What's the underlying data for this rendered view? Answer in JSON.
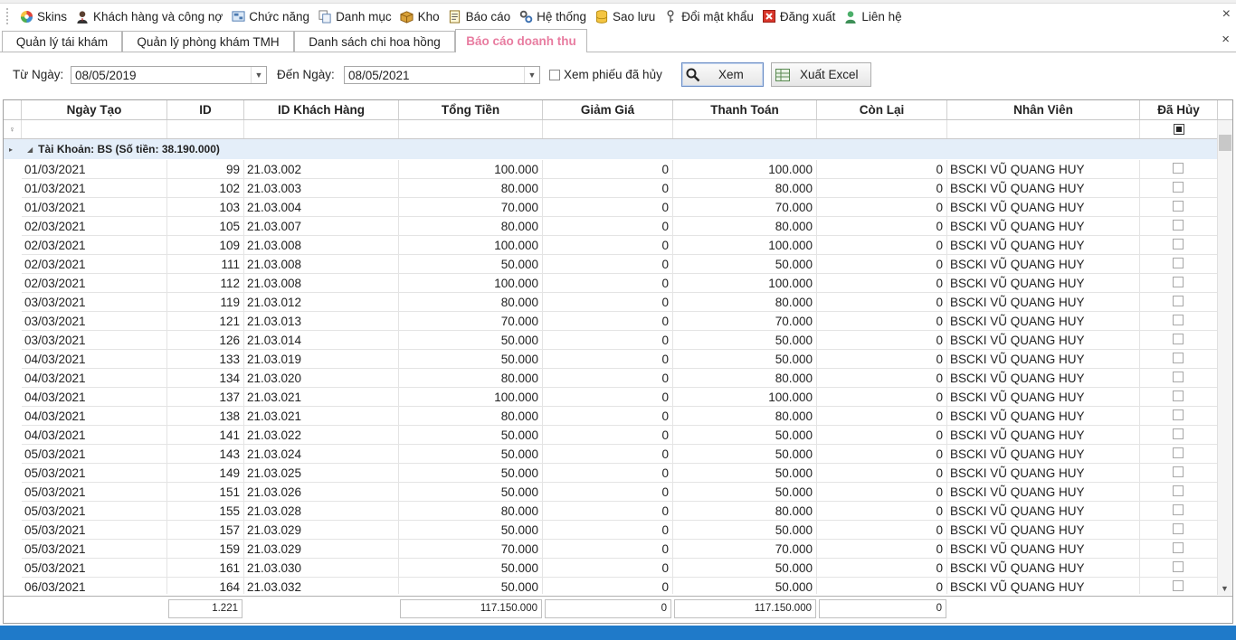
{
  "menu": {
    "items": [
      {
        "label": "Skins",
        "icon": "palette-icon"
      },
      {
        "label": "Khách hàng và công nợ",
        "icon": "user-icon"
      },
      {
        "label": "Chức năng",
        "icon": "function-icon"
      },
      {
        "label": "Danh mục",
        "icon": "category-icon"
      },
      {
        "label": "Kho",
        "icon": "box-icon"
      },
      {
        "label": "Báo cáo",
        "icon": "report-icon"
      },
      {
        "label": "Hệ thống",
        "icon": "settings-icon"
      },
      {
        "label": "Sao lưu",
        "icon": "database-icon"
      },
      {
        "label": "Đổi mật khẩu",
        "icon": "key-icon"
      },
      {
        "label": "Đăng xuất",
        "icon": "logout-icon"
      },
      {
        "label": "Liên hệ",
        "icon": "contact-icon"
      }
    ],
    "close_glyph": "×"
  },
  "tabs": [
    {
      "label": "Quản lý tái khám"
    },
    {
      "label": "Quản lý phòng khám TMH"
    },
    {
      "label": "Danh sách chi hoa hồng"
    },
    {
      "label": "Báo cáo doanh thu",
      "active": true
    }
  ],
  "filter": {
    "from_label": "Từ Ngày:",
    "from_value": "08/05/2019",
    "to_label": "Đến Ngày:",
    "to_value": "08/05/2021",
    "show_cancelled_label": "Xem phiếu đã hủy",
    "view_button": "Xem",
    "export_button": "Xuất Excel"
  },
  "grid": {
    "columns": [
      "Ngày Tạo",
      "ID",
      "ID Khách Hàng",
      "Tổng Tiền",
      "Giảm Giá",
      "Thanh Toán",
      "Còn Lại",
      "Nhân Viên",
      "Đã Hủy"
    ],
    "group_label": "Tài Khoản: BS (Số tiền: 38.190.000)",
    "rows": [
      [
        "01/03/2021",
        "99",
        "21.03.002",
        "100.000",
        "0",
        "100.000",
        "0",
        "BSCKI VŨ QUANG HUY"
      ],
      [
        "01/03/2021",
        "102",
        "21.03.003",
        "80.000",
        "0",
        "80.000",
        "0",
        "BSCKI VŨ QUANG HUY"
      ],
      [
        "01/03/2021",
        "103",
        "21.03.004",
        "70.000",
        "0",
        "70.000",
        "0",
        "BSCKI VŨ QUANG HUY"
      ],
      [
        "02/03/2021",
        "105",
        "21.03.007",
        "80.000",
        "0",
        "80.000",
        "0",
        "BSCKI VŨ QUANG HUY"
      ],
      [
        "02/03/2021",
        "109",
        "21.03.008",
        "100.000",
        "0",
        "100.000",
        "0",
        "BSCKI VŨ QUANG HUY"
      ],
      [
        "02/03/2021",
        "111",
        "21.03.008",
        "50.000",
        "0",
        "50.000",
        "0",
        "BSCKI VŨ QUANG HUY"
      ],
      [
        "02/03/2021",
        "112",
        "21.03.008",
        "100.000",
        "0",
        "100.000",
        "0",
        "BSCKI VŨ QUANG HUY"
      ],
      [
        "03/03/2021",
        "119",
        "21.03.012",
        "80.000",
        "0",
        "80.000",
        "0",
        "BSCKI VŨ QUANG HUY"
      ],
      [
        "03/03/2021",
        "121",
        "21.03.013",
        "70.000",
        "0",
        "70.000",
        "0",
        "BSCKI VŨ QUANG HUY"
      ],
      [
        "03/03/2021",
        "126",
        "21.03.014",
        "50.000",
        "0",
        "50.000",
        "0",
        "BSCKI VŨ QUANG HUY"
      ],
      [
        "04/03/2021",
        "133",
        "21.03.019",
        "50.000",
        "0",
        "50.000",
        "0",
        "BSCKI VŨ QUANG HUY"
      ],
      [
        "04/03/2021",
        "134",
        "21.03.020",
        "80.000",
        "0",
        "80.000",
        "0",
        "BSCKI VŨ QUANG HUY"
      ],
      [
        "04/03/2021",
        "137",
        "21.03.021",
        "100.000",
        "0",
        "100.000",
        "0",
        "BSCKI VŨ QUANG HUY"
      ],
      [
        "04/03/2021",
        "138",
        "21.03.021",
        "80.000",
        "0",
        "80.000",
        "0",
        "BSCKI VŨ QUANG HUY"
      ],
      [
        "04/03/2021",
        "141",
        "21.03.022",
        "50.000",
        "0",
        "50.000",
        "0",
        "BSCKI VŨ QUANG HUY"
      ],
      [
        "05/03/2021",
        "143",
        "21.03.024",
        "50.000",
        "0",
        "50.000",
        "0",
        "BSCKI VŨ QUANG HUY"
      ],
      [
        "05/03/2021",
        "149",
        "21.03.025",
        "50.000",
        "0",
        "50.000",
        "0",
        "BSCKI VŨ QUANG HUY"
      ],
      [
        "05/03/2021",
        "151",
        "21.03.026",
        "50.000",
        "0",
        "50.000",
        "0",
        "BSCKI VŨ QUANG HUY"
      ],
      [
        "05/03/2021",
        "155",
        "21.03.028",
        "80.000",
        "0",
        "80.000",
        "0",
        "BSCKI VŨ QUANG HUY"
      ],
      [
        "05/03/2021",
        "157",
        "21.03.029",
        "50.000",
        "0",
        "50.000",
        "0",
        "BSCKI VŨ QUANG HUY"
      ],
      [
        "05/03/2021",
        "159",
        "21.03.029",
        "70.000",
        "0",
        "70.000",
        "0",
        "BSCKI VŨ QUANG HUY"
      ],
      [
        "05/03/2021",
        "161",
        "21.03.030",
        "50.000",
        "0",
        "50.000",
        "0",
        "BSCKI VŨ QUANG HUY"
      ],
      [
        "06/03/2021",
        "164",
        "21.03.032",
        "50.000",
        "0",
        "50.000",
        "0",
        "BSCKI VŨ QUANG HUY"
      ]
    ],
    "footer": {
      "count": "1.221",
      "total": "117.150.000",
      "discount": "0",
      "paid": "117.150.000",
      "remaining": "0"
    }
  },
  "colors": {
    "active_tab": "#e87ca0",
    "group_row_bg": "#e4eef9",
    "status_bar": "#1f7ac9"
  }
}
